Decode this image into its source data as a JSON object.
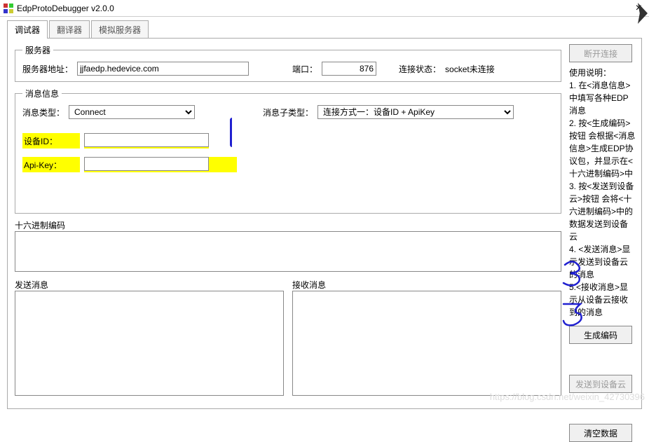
{
  "window": {
    "title": "EdpProtoDebugger v2.0.0",
    "close": "×"
  },
  "tabs": {
    "t1": "调试器",
    "t2": "翻译器",
    "t3": "模拟服务器"
  },
  "server": {
    "legend": "服务器",
    "addrLabel": "服务器地址：",
    "addr": "jjfaedp.hedevice.com",
    "portLabel": "端口：",
    "port": "876",
    "statusLabel": "连接状态：",
    "status": "socket未连接"
  },
  "msg": {
    "legend": "消息信息",
    "typeLabel": "消息类型：",
    "type": "Connect",
    "subtypeLabel": "消息子类型：",
    "subtype": "连接方式一：设备ID + ApiKey",
    "devIdLabel": "设备ID：",
    "devId": "",
    "apiKeyLabel": "Api-Key：",
    "apiKey": ""
  },
  "hex": {
    "label": "十六进制编码",
    "value": ""
  },
  "send": {
    "label": "发送消息",
    "value": ""
  },
  "recv": {
    "label": "接收消息",
    "value": ""
  },
  "buttons": {
    "disconnect": "断开连接",
    "generate": "生成编码",
    "sendCloud": "发送到设备云",
    "clear": "清空数据"
  },
  "instr": {
    "header": "使用说明：",
    "l1": "1. 在<消息信息>中填写各种EDP消息",
    "l2": "2. 按<生成编码>按钮 会根据<消息信息>生成EDP协议包，并显示在<十六进制编码>中",
    "l3": "3. 按<发送到设备云>按钮 会将<十六进制编码>中的数据发送到设备云",
    "l4": "4. <发送消息>显示发送到设备云的消息",
    "l5": "5.<接收消息>显示从设备云接收到的消息"
  },
  "watermark": "https://blog.csdn.net/weixin_42730396"
}
